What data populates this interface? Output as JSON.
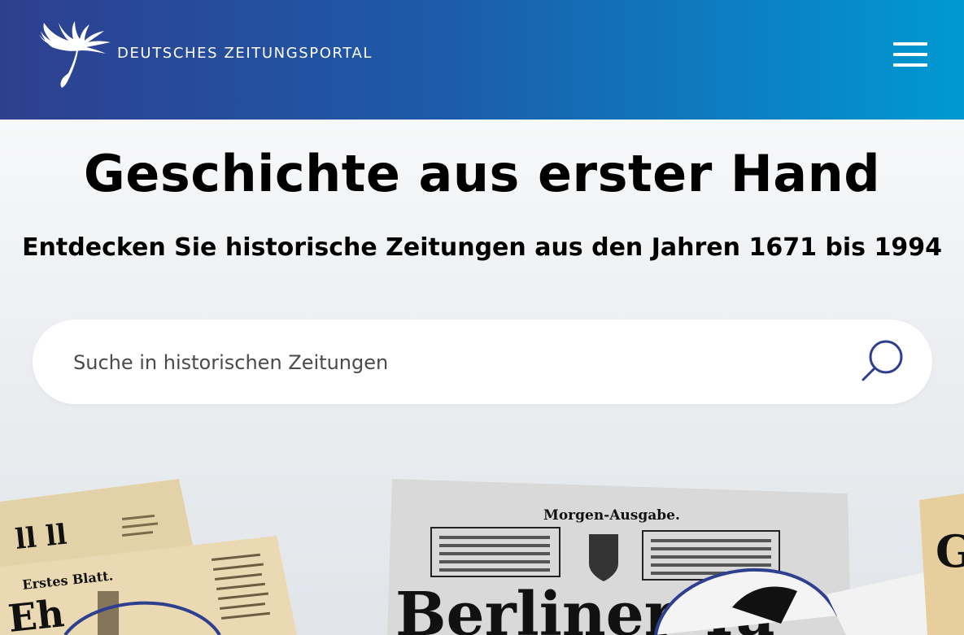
{
  "header": {
    "logo_text": "DEUTSCHES ZEITUNGSPORTAL",
    "logo_icon": "dandelion-feather-icon",
    "menu_icon": "hamburger-menu-icon",
    "background_gradient": [
      "#2e3f8f",
      "#0099d0"
    ]
  },
  "hero": {
    "title": "Geschichte aus erster Hand",
    "subtitle": "Entdecken Sie historische Zeitungen aus den Jahren 1671 bis 1994"
  },
  "search": {
    "placeholder": "Suche in historischen Zeitungen",
    "value": "",
    "icon": "search-icon",
    "icon_color": "#2d3f8e"
  },
  "newspapers": {
    "center_edition": "Morgen-Ausgabe.",
    "center_masthead": "Berliner Ta",
    "left_masthead": "Erstes Blatt."
  }
}
